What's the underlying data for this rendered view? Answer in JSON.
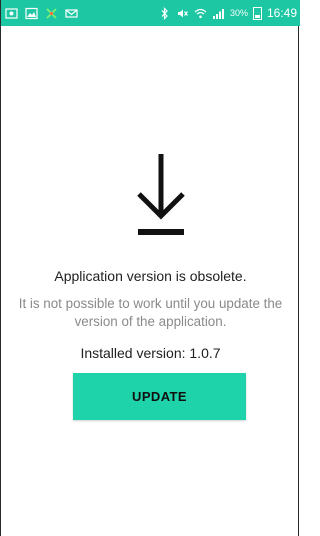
{
  "status_bar": {
    "battery": "30%",
    "time": "16:49",
    "icons": [
      "screenshot-icon",
      "image-icon",
      "app-icon",
      "email-icon",
      "bluetooth-icon",
      "mute-icon",
      "wifi-icon",
      "signal-icon",
      "battery-icon"
    ],
    "background": "#1ec7a3"
  },
  "main": {
    "icon": "download-icon",
    "title": "Application version is obsolete.",
    "message": "It is not possible to work until you update the version of the application.",
    "installed_version": "Installed version: 1.0.7",
    "update_button": "UPDATE",
    "button_color": "#1ed3a9"
  }
}
